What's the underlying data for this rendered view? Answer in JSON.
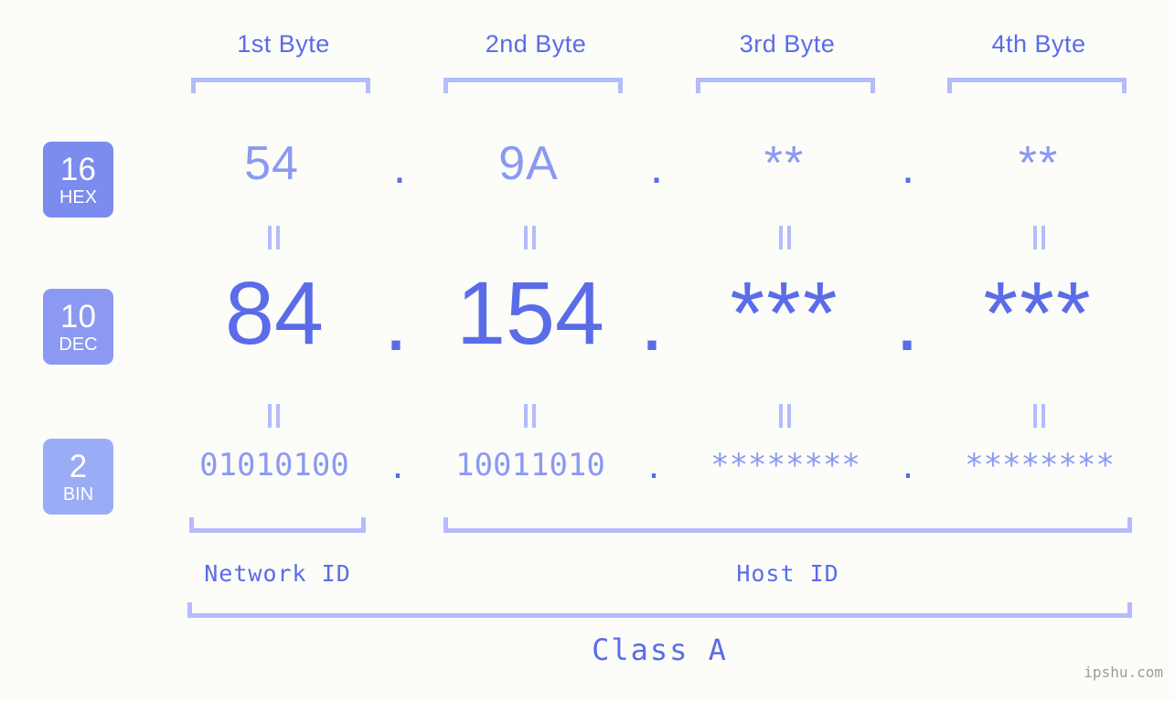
{
  "page": {
    "background_color": "#fcfdf9",
    "accent_color": "#5a6ce8",
    "accent_light_color": "#8b99f2",
    "bracket_color": "#b4bcfb",
    "watermark": "ipshu.com"
  },
  "columns": [
    {
      "label": "1st Byte"
    },
    {
      "label": "2nd Byte"
    },
    {
      "label": "3rd Byte"
    },
    {
      "label": "4th Byte"
    }
  ],
  "bases": [
    {
      "number": "16",
      "name": "HEX",
      "color": "#7b8bee"
    },
    {
      "number": "10",
      "name": "DEC",
      "color": "#8b99f2"
    },
    {
      "number": "2",
      "name": "BIN",
      "color": "#9bacf6"
    }
  ],
  "rows": {
    "hex": {
      "base_number": "16",
      "base_name": "HEX",
      "values": [
        "54",
        "9A",
        "**",
        "**"
      ],
      "separators": [
        ".",
        ".",
        "."
      ]
    },
    "dec": {
      "base_number": "10",
      "base_name": "DEC",
      "values": [
        "84",
        "154",
        "***",
        "***"
      ],
      "separators": [
        ".",
        ".",
        "."
      ]
    },
    "bin": {
      "base_number": "2",
      "base_name": "BIN",
      "values": [
        "01010100",
        "10011010",
        "********",
        "********"
      ],
      "separators": [
        ".",
        ".",
        "."
      ]
    }
  },
  "segments": {
    "network_id": "Network ID",
    "host_id": "Host ID",
    "class": "Class A"
  },
  "equality_marks": {
    "symbol": "=",
    "count_per_row_gap": 4,
    "rows": 2
  }
}
